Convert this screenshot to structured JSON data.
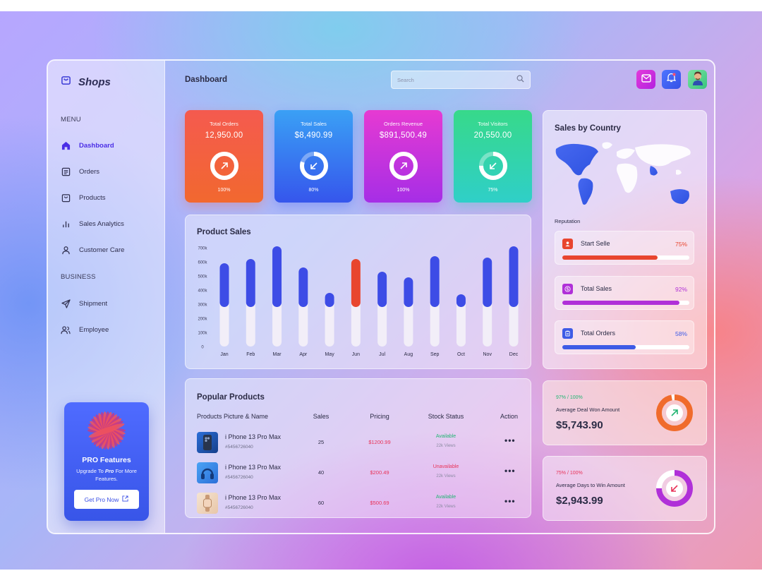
{
  "brand": {
    "name": "Shops"
  },
  "sidebar": {
    "menu_heading": "MENU",
    "business_heading": "BUSINESS",
    "items": [
      {
        "label": "Dashboard",
        "icon": "home-icon",
        "active": true
      },
      {
        "label": "Orders",
        "icon": "list-icon"
      },
      {
        "label": "Products",
        "icon": "bag-icon"
      },
      {
        "label": "Sales Analytics",
        "icon": "bar-chart-icon"
      },
      {
        "label": "Customer Care",
        "icon": "user-icon"
      },
      {
        "label": "Shipment",
        "icon": "send-icon"
      },
      {
        "label": "Employee",
        "icon": "users-icon"
      }
    ]
  },
  "pro": {
    "title": "PRO Features",
    "sub_prefix": "Upgrade To ",
    "sub_em": "Pro",
    "sub_suffix": " For More Features.",
    "button": "Get Pro Now"
  },
  "header": {
    "title": "Dashboard",
    "search_placeholder": "Search"
  },
  "stats": [
    {
      "title": "Total Orders",
      "value": "12,950.00",
      "percent": "100%",
      "fraction": 1.0,
      "arrow": "up-right"
    },
    {
      "title": "Total Sales",
      "value": "$8,490.99",
      "percent": "80%",
      "fraction": 0.8,
      "arrow": "down-left"
    },
    {
      "title": "Orders Revenue",
      "value": "$891,500.49",
      "percent": "100%",
      "fraction": 1.0,
      "arrow": "up-right"
    },
    {
      "title": "Total Visitors",
      "value": "20,550.00",
      "percent": "75%",
      "fraction": 0.75,
      "arrow": "down-left"
    }
  ],
  "product_sales": {
    "title": "Product Sales"
  },
  "chart_data": {
    "type": "bar",
    "title": "Product Sales",
    "categories": [
      "Jan",
      "Feb",
      "Mar",
      "Apr",
      "May",
      "Jun",
      "Jul",
      "Aug",
      "Sep",
      "Oct",
      "Nov",
      "Dec"
    ],
    "values": [
      590000,
      620000,
      710000,
      560000,
      380000,
      620000,
      530000,
      490000,
      640000,
      370000,
      630000,
      710000
    ],
    "y_ticks": [
      "700k",
      "600k",
      "500k",
      "400k",
      "300k",
      "200k",
      "100k",
      "0"
    ],
    "ylim": [
      0,
      700000
    ],
    "highlight": "Jun",
    "colors": {
      "bar": "#3d4ce6",
      "highlight": "#e8452e",
      "track": "#f2eef8"
    }
  },
  "popular": {
    "title": "Popular Products",
    "columns": [
      "Products Picture & Name",
      "Sales",
      "Pricing",
      "Stock Status",
      "Action"
    ],
    "rows": [
      {
        "name": "i Phone 13 Pro Max",
        "id": "#5456726040",
        "sales": "25",
        "price": "$1200.99",
        "status": "Available",
        "views": "22k Views",
        "action": "•••"
      },
      {
        "name": "i Phone 13 Pro Max",
        "id": "#5456726040",
        "sales": "40",
        "price": "$200.49",
        "status": "Unavailable",
        "views": "22k Views",
        "action": "•••"
      },
      {
        "name": "i Phone 13 Pro Max",
        "id": "#5456726040",
        "sales": "60",
        "price": "$500.69",
        "status": "Available",
        "views": "22k Views",
        "action": "•••"
      }
    ]
  },
  "country": {
    "title": "Sales by Country",
    "reputation_label": "Reputation",
    "items": [
      {
        "label": "Start Selle",
        "percent": "75%",
        "fraction": 0.75,
        "color": "#e8452e"
      },
      {
        "label": "Total Sales",
        "percent": "92%",
        "fraction": 0.92,
        "color": "#b030d8"
      },
      {
        "label": "Total Orders",
        "percent": "58%",
        "fraction": 0.58,
        "color": "#3d5be6"
      }
    ]
  },
  "deals": [
    {
      "pct": "97% / 100%",
      "label": "Average Deal Won Amount",
      "value": "$5,743.90",
      "fraction": 0.97,
      "color": "#f06b2c",
      "pct_color": "#22b573"
    },
    {
      "pct": "75% / 100%",
      "label": "Average Days to Win Amount",
      "value": "$2,943.99",
      "fraction": 0.75,
      "color": "#b030d8",
      "pct_color": "#e8345a"
    }
  ]
}
